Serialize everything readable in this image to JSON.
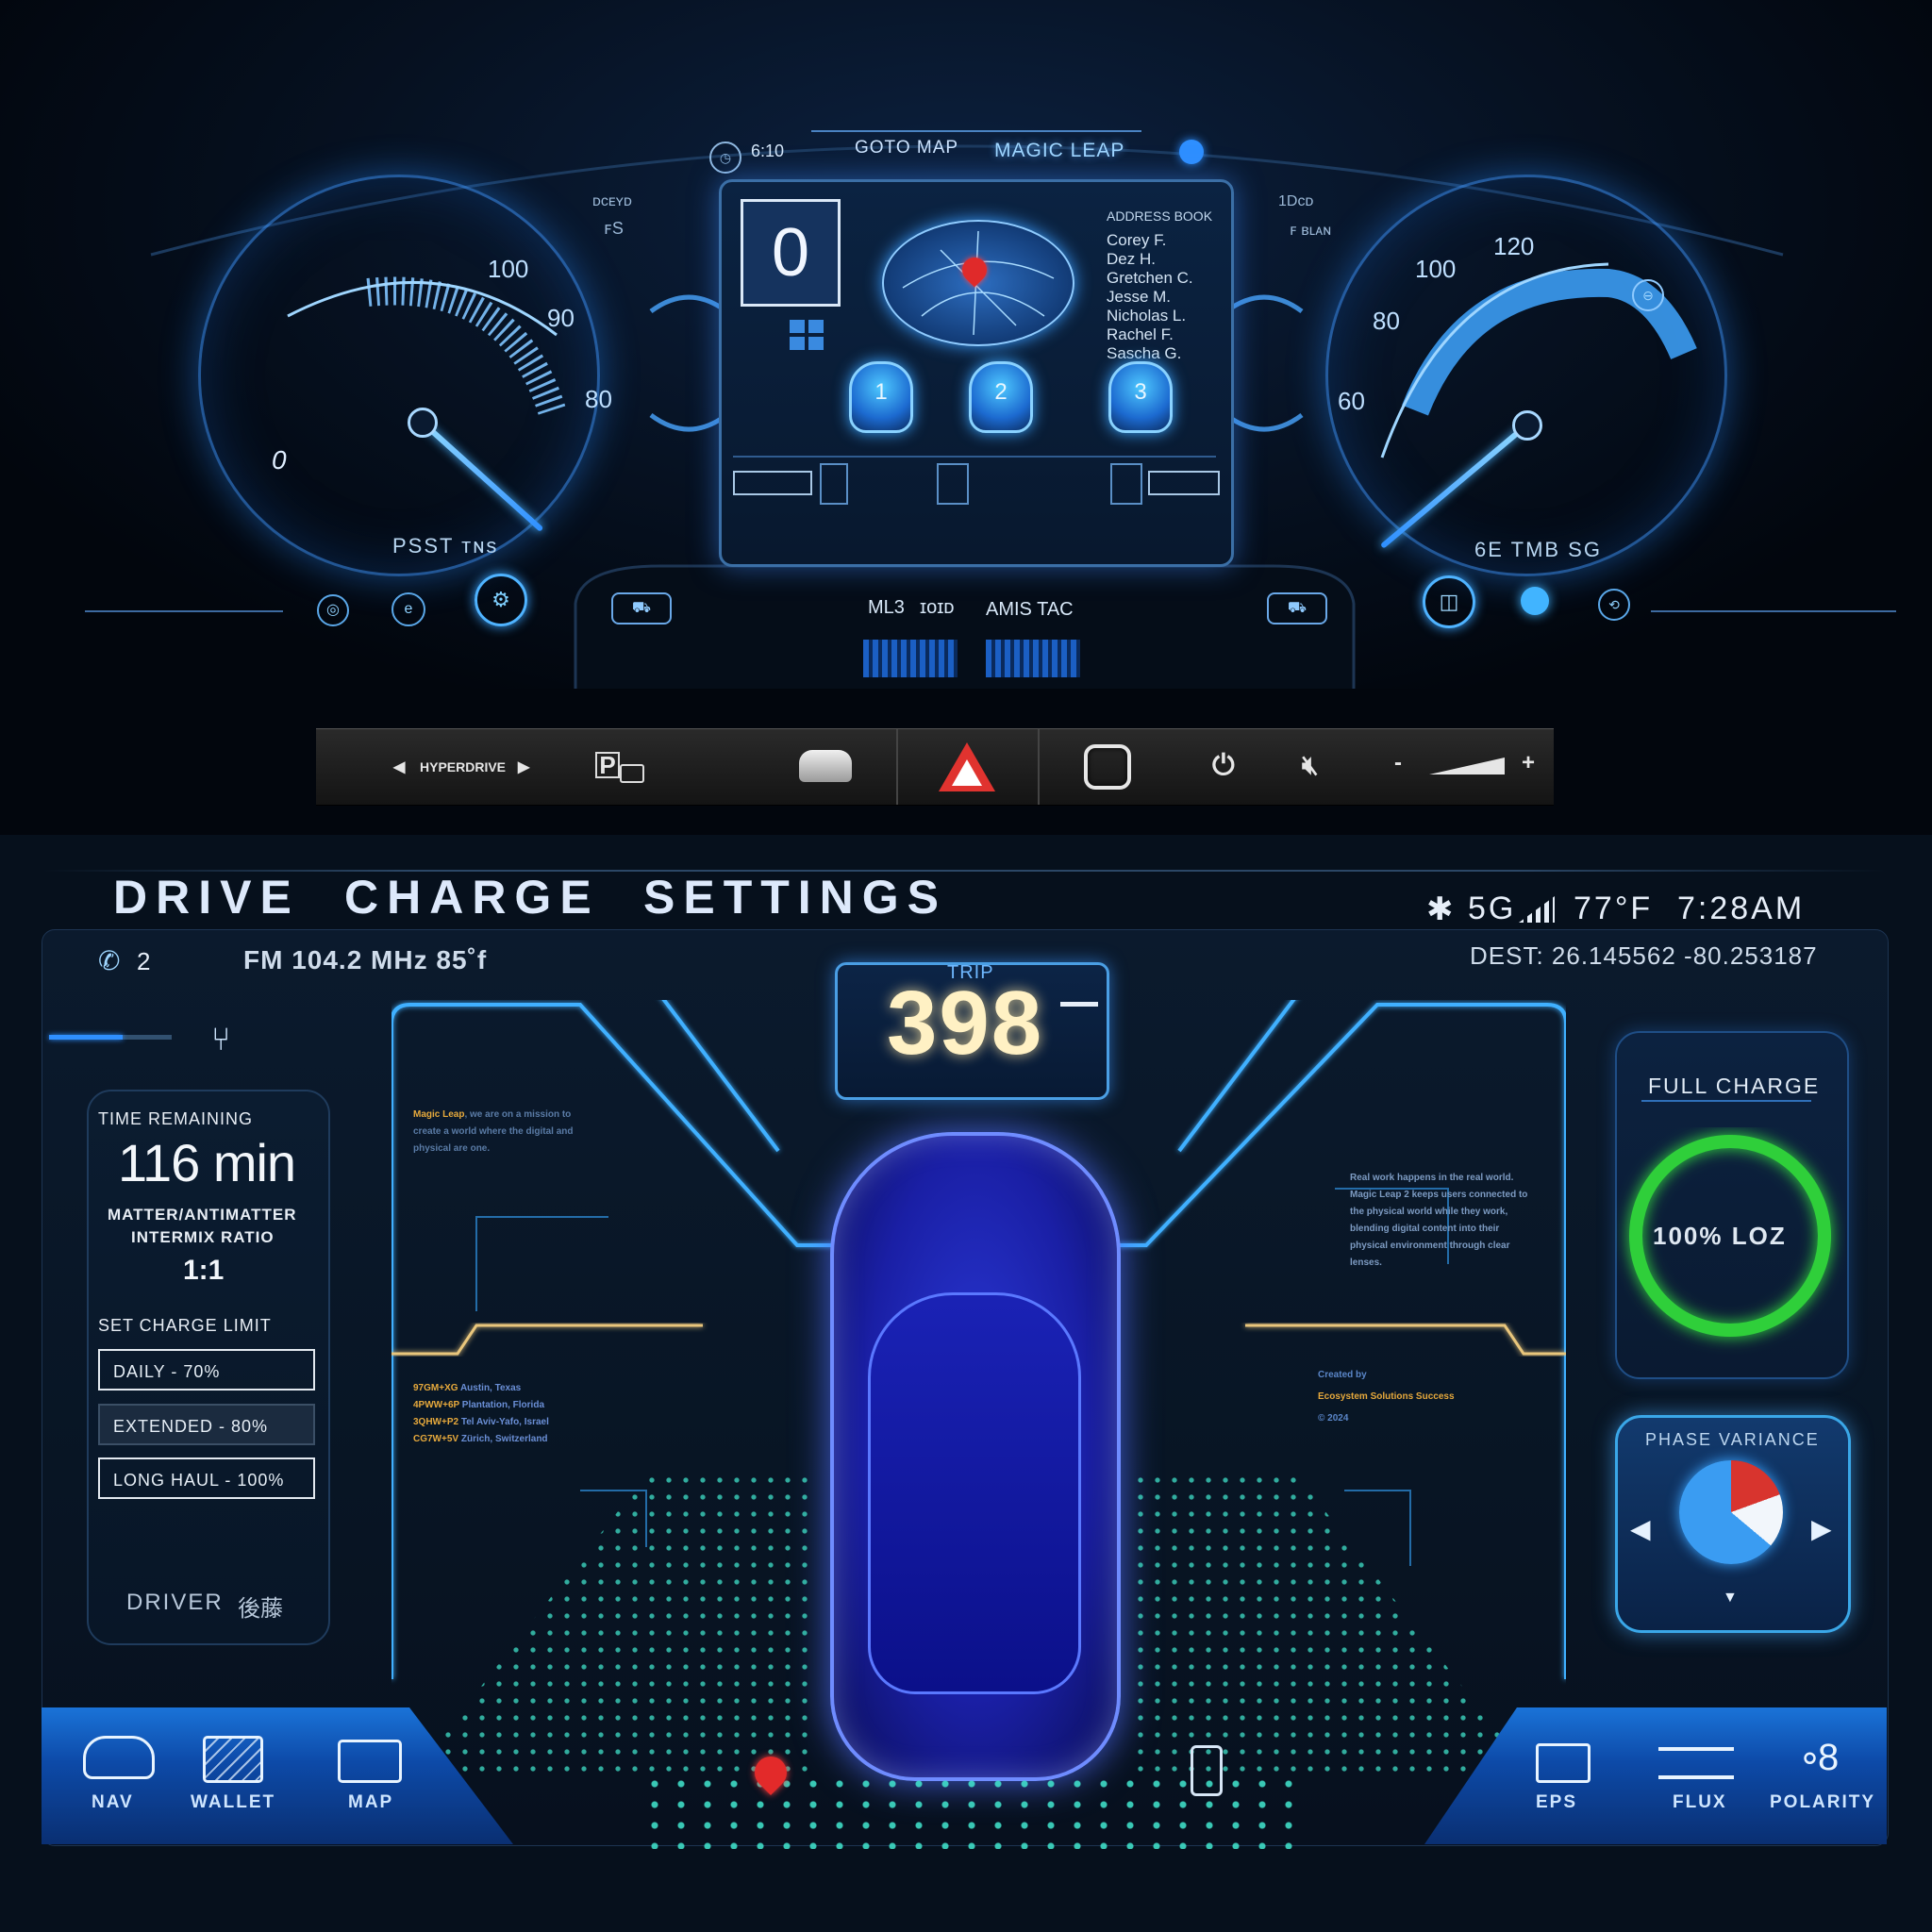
{
  "top_dashboard": {
    "left_cluster": {
      "ticks": [
        "100",
        "90",
        "80"
      ],
      "gear": "0",
      "corner_labels": [
        "ᴅᴄᴇʏᴅ",
        "ꜰS"
      ],
      "label": "PSST  ᴛɴs"
    },
    "right_cluster": {
      "ticks": [
        "120",
        "100",
        "80",
        "60"
      ],
      "corner_labels": [
        "1Dᴄᴅ",
        "ꜰ ʙʟᴀɴ"
      ],
      "label": "6E TMB SG"
    },
    "clock": "6:10",
    "tabs": [
      "GOTO MAP",
      "MAGIC LEAP"
    ],
    "center_screen": {
      "big_digit": "0",
      "address_book_title": "ADDRESS BOOK",
      "contacts": [
        "Corey F.",
        "Dez H.",
        "Gretchen C.",
        "Jesse M.",
        "Nicholas L.",
        "Rachel F.",
        "Sascha G."
      ],
      "seats": [
        "1",
        "2",
        "3"
      ]
    },
    "lower_center": [
      "ML3",
      "ɪᴏɪᴅ",
      "AMIS TAC"
    ]
  },
  "control_bar": {
    "mode_label": "HYPERDRIVE",
    "volume_minus": "-",
    "volume_plus": "+"
  },
  "bottom": {
    "menu": [
      "DRIVE",
      "CHARGE",
      "SETTINGS"
    ],
    "status": {
      "signal": "5G",
      "temperature": "77°F",
      "time": "7:28AM",
      "destination": "DEST: 26.145562  -80.253187"
    },
    "calls": "2",
    "radio": "FM  104.2 MHz  85˚f",
    "left_card": {
      "time_label": "TIME REMAINING",
      "time_value": "116 min",
      "ratio_label_1": "MATTER/ANTIMATTER",
      "ratio_label_2": "INTERMIX RATIO",
      "ratio_value": "1:1",
      "charge_limit_label": "SET CHARGE LIMIT",
      "options": [
        "DAILY - 70%",
        "EXTENDED - 80%",
        "LONG HAUL - 100%"
      ],
      "selected_option": "EXTENDED - 80%",
      "driver_label": "DRIVER",
      "driver_name": "後藤"
    },
    "trip": {
      "label": "TRIP",
      "value": "398"
    },
    "note_left": {
      "brand": "Magic Leap",
      "text": ", we are on a mission to create a world where the digital and physical are one."
    },
    "note_right": "Real work happens in the real world. Magic Leap 2 keeps users connected to the physical world while they work, blending digital content into their physical environment through clear lenses.",
    "locations": [
      {
        "code": "97GM+XG",
        "place": "Austin, Texas"
      },
      {
        "code": "4PWW+6P",
        "place": "Plantation, Florida"
      },
      {
        "code": "3QHW+P2",
        "place": "Tel Aviv-Yafo, Israel"
      },
      {
        "code": "CG7W+5V",
        "place": "Zürich, Switzerland"
      }
    ],
    "credits": {
      "created_by": "Created by",
      "org": "Ecosystem Solutions Success",
      "year": "© 2024"
    },
    "charge": {
      "title": "FULL CHARGE",
      "ring_label": "100% LOZ",
      "level": 1.0,
      "ring_color": "#2fcf3a"
    },
    "phase": {
      "title": "PHASE VARIANCE"
    },
    "nav_left": [
      {
        "label": "NAV",
        "icon": "nav-car-icon"
      },
      {
        "label": "WALLET",
        "icon": "wallet-card-icon"
      },
      {
        "label": "MAP",
        "icon": "map-folder-icon"
      }
    ],
    "nav_right": [
      {
        "label": "EPS",
        "icon": "eps-icon"
      },
      {
        "label": "FLUX",
        "icon": "flux-icon"
      },
      {
        "label": "POLARITY",
        "icon": "polarity-icon"
      }
    ]
  }
}
